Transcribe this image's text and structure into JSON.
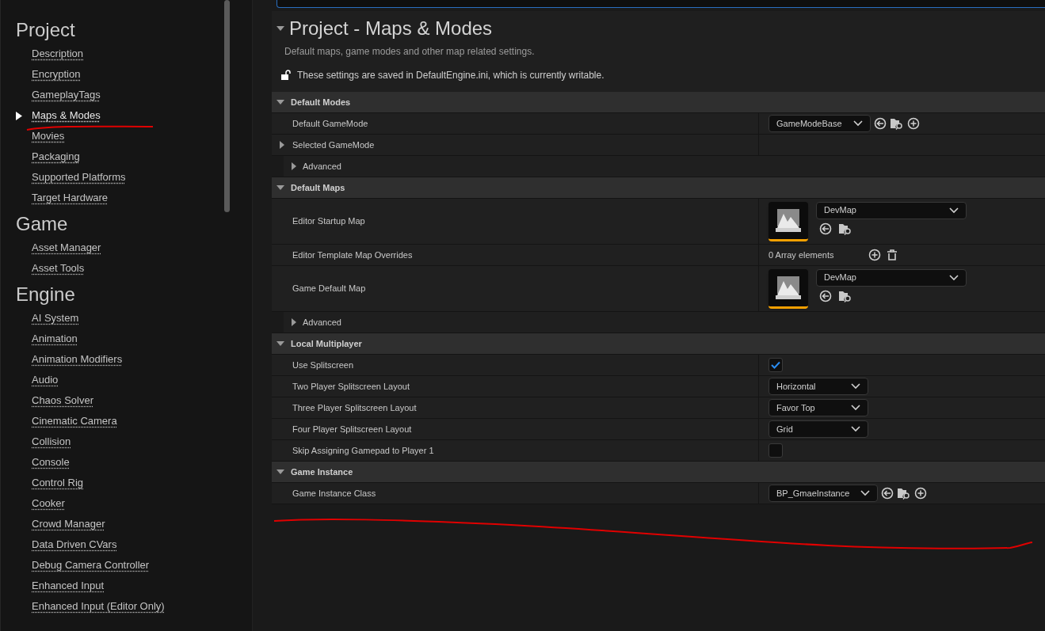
{
  "sidebar": {
    "groups": [
      {
        "title": "Project",
        "items": [
          {
            "label": "Description",
            "selected": false
          },
          {
            "label": "Encryption",
            "selected": false
          },
          {
            "label": "GameplayTags",
            "selected": false
          },
          {
            "label": "Maps & Modes",
            "selected": true
          },
          {
            "label": "Movies",
            "selected": false
          },
          {
            "label": "Packaging",
            "selected": false
          },
          {
            "label": "Supported Platforms",
            "selected": false
          },
          {
            "label": "Target Hardware",
            "selected": false
          }
        ]
      },
      {
        "title": "Game",
        "items": [
          {
            "label": "Asset Manager",
            "selected": false
          },
          {
            "label": "Asset Tools",
            "selected": false
          }
        ]
      },
      {
        "title": "Engine",
        "items": [
          {
            "label": "AI System",
            "selected": false
          },
          {
            "label": "Animation",
            "selected": false
          },
          {
            "label": "Animation Modifiers",
            "selected": false
          },
          {
            "label": "Audio",
            "selected": false
          },
          {
            "label": "Chaos Solver",
            "selected": false
          },
          {
            "label": "Cinematic Camera",
            "selected": false
          },
          {
            "label": "Collision",
            "selected": false
          },
          {
            "label": "Console",
            "selected": false
          },
          {
            "label": "Control Rig",
            "selected": false
          },
          {
            "label": "Cooker",
            "selected": false
          },
          {
            "label": "Crowd Manager",
            "selected": false
          },
          {
            "label": "Data Driven CVars",
            "selected": false
          },
          {
            "label": "Debug Camera Controller",
            "selected": false
          },
          {
            "label": "Enhanced Input",
            "selected": false
          },
          {
            "label": "Enhanced Input (Editor Only)",
            "selected": false
          }
        ]
      }
    ]
  },
  "page": {
    "title": "Project - Maps & Modes",
    "expanded": true,
    "description": "Default maps, game modes and other map related settings.",
    "notice": "These settings are saved in DefaultEngine.ini, which is currently writable."
  },
  "sections": [
    {
      "title": "Default Modes",
      "expanded": true,
      "rows": [
        {
          "kind": "class",
          "label": "Default GameMode",
          "value": "GameModeBase"
        },
        {
          "kind": "expander",
          "label": "Selected GameMode",
          "expanded": false
        },
        {
          "kind": "advanced",
          "label": "Advanced",
          "expanded": false
        }
      ]
    },
    {
      "title": "Default Maps",
      "expanded": true,
      "rows": [
        {
          "kind": "map",
          "label": "Editor Startup Map",
          "value": "DevMap"
        },
        {
          "kind": "array",
          "label": "Editor Template Map Overrides",
          "value": "0 Array elements"
        },
        {
          "kind": "map",
          "label": "Game Default Map",
          "value": "DevMap"
        },
        {
          "kind": "advanced",
          "label": "Advanced",
          "expanded": false
        }
      ]
    },
    {
      "title": "Local Multiplayer",
      "expanded": true,
      "rows": [
        {
          "kind": "checkbox",
          "label": "Use Splitscreen",
          "checked": true
        },
        {
          "kind": "enum",
          "label": "Two Player Splitscreen Layout",
          "value": "Horizontal"
        },
        {
          "kind": "enum",
          "label": "Three Player Splitscreen Layout",
          "value": "Favor Top"
        },
        {
          "kind": "enum",
          "label": "Four Player Splitscreen Layout",
          "value": "Grid"
        },
        {
          "kind": "checkbox",
          "label": "Skip Assigning Gamepad to Player 1",
          "checked": false
        }
      ]
    },
    {
      "title": "Game Instance",
      "expanded": true,
      "rows": [
        {
          "kind": "class",
          "label": "Game Instance Class",
          "value": "BP_GmaeInstance"
        }
      ]
    }
  ]
}
